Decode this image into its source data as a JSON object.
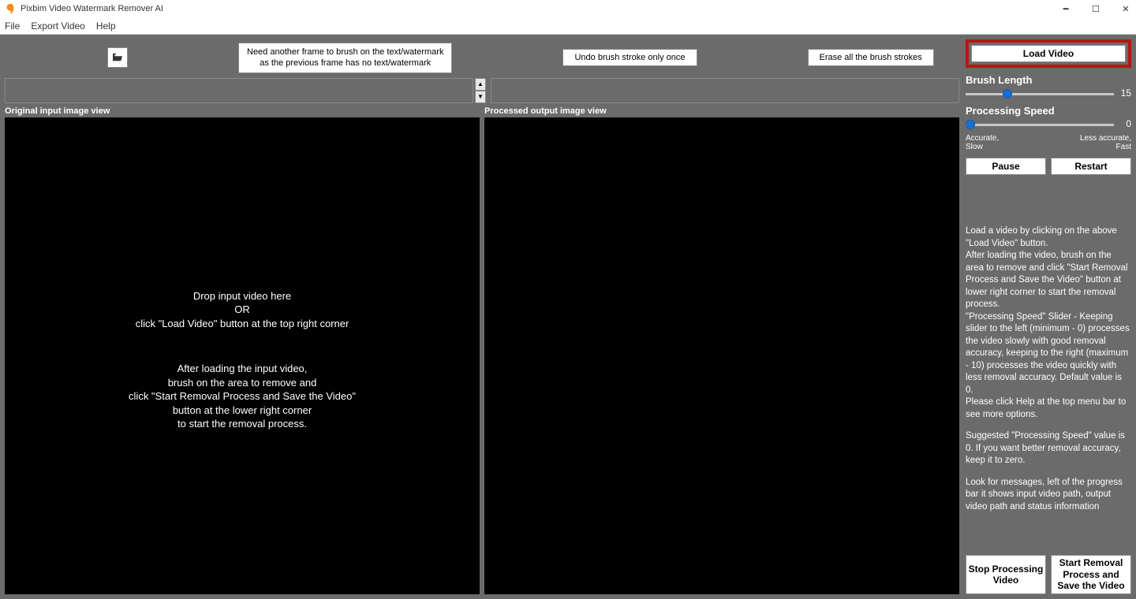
{
  "title": "Pixbim Video Watermark Remover AI",
  "menu": {
    "file": "File",
    "export": "Export Video",
    "help": "Help"
  },
  "toolbar": {
    "tooltip_l1": "Need another frame to brush on the text/watermark",
    "tooltip_l2": "as the previous frame has no text/watermark",
    "undo": "Undo brush stroke only once",
    "erase": "Erase all the brush strokes"
  },
  "labels": {
    "original": "Original input image view",
    "processed": "Processed output image view"
  },
  "drop": {
    "p1_l1": "Drop input video here",
    "p1_l2": "OR",
    "p1_l3": "click \"Load Video\" button at the top right corner",
    "p2_l1": "After loading the input video,",
    "p2_l2": "brush on the area to remove and",
    "p2_l3": "click \"Start Removal Process and Save the Video\"",
    "p2_l4": "button at the lower right corner",
    "p2_l5": "to start the removal process."
  },
  "side": {
    "load": "Load Video",
    "brush_label": "Brush Length",
    "brush_val": "15",
    "speed_label": "Processing Speed",
    "speed_val": "0",
    "hint_left_l1": "Accurate,",
    "hint_left_l2": "Slow",
    "hint_right_l1": "Less accurate,",
    "hint_right_l2": "Fast",
    "pause": "Pause",
    "restart": "Restart",
    "info_p1": "Load a video by clicking on the above \"Load Video\" button.",
    "info_p1b": "After loading the video, brush on the area to remove and click \"Start Removal Process and Save the Video\" button at lower right corner to start the removal process.",
    "info_p1c": "\"Processing Speed\" Slider - Keeping slider to the left (minimum - 0) processes the video slowly with good removal accuracy, keeping to the right (maximum - 10) processes the video quickly with less removal accuracy. Default value is 0.",
    "info_p1d": "Please click Help at the top menu bar to see more options.",
    "info_p2": "Suggested \"Processing Speed\" value is 0. If you want better removal accuracy, keep it to zero.",
    "info_p3": "Look for messages, left of the progress bar it shows input video path, output video path and status information",
    "stop": "Stop Processing Video",
    "start": "Start Removal Process and Save the Video"
  }
}
